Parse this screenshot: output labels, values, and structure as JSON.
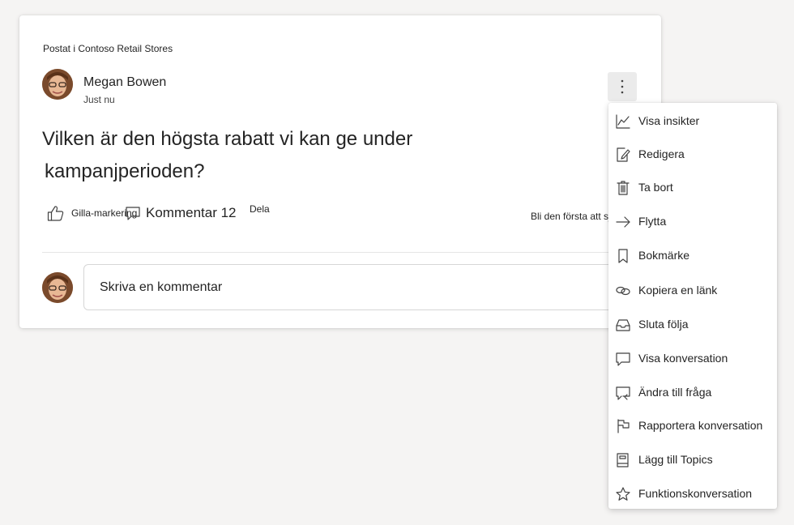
{
  "post": {
    "posted_in": "Postat i Contoso Retail Stores",
    "author": "Megan Bowen",
    "time": "Just nu",
    "question_line1": "Vilken är den högsta rabatt vi kan ge under",
    "question_line2": "kampanjperioden?",
    "like_label": "Gilla-markering",
    "comment_label": "Kommentar 12",
    "share_label": "Dela",
    "first_like": "Bli den första att sjuk",
    "comment_placeholder": "Skriva en kommentar"
  },
  "menu": {
    "items": [
      {
        "label": "Visa insikter",
        "icon": "chart-line-icon"
      },
      {
        "label": "Redigera",
        "icon": "edit-icon"
      },
      {
        "label": "Ta bort",
        "icon": "trash-icon"
      },
      {
        "label": "Flytta",
        "icon": "arrow-right-icon"
      },
      {
        "label": "Bokmärke",
        "icon": "bookmark-icon"
      },
      {
        "label": "Kopiera en länk",
        "icon": "link-icon"
      },
      {
        "label": "Sluta följa",
        "icon": "inbox-icon"
      },
      {
        "label": "Visa konversation",
        "icon": "chat-icon"
      },
      {
        "label": "Ändra till fråga",
        "icon": "chat-question-icon"
      },
      {
        "label": "Rapportera konversation",
        "icon": "flag-icon"
      },
      {
        "label": "Lägg till Topics",
        "icon": "book-icon"
      },
      {
        "label": "Funktionskonversation",
        "icon": "star-icon"
      }
    ]
  },
  "colors": {
    "background": "#f5f4f3",
    "card": "#ffffff",
    "text": "#242424",
    "more_button_bg": "#ebebeb"
  }
}
